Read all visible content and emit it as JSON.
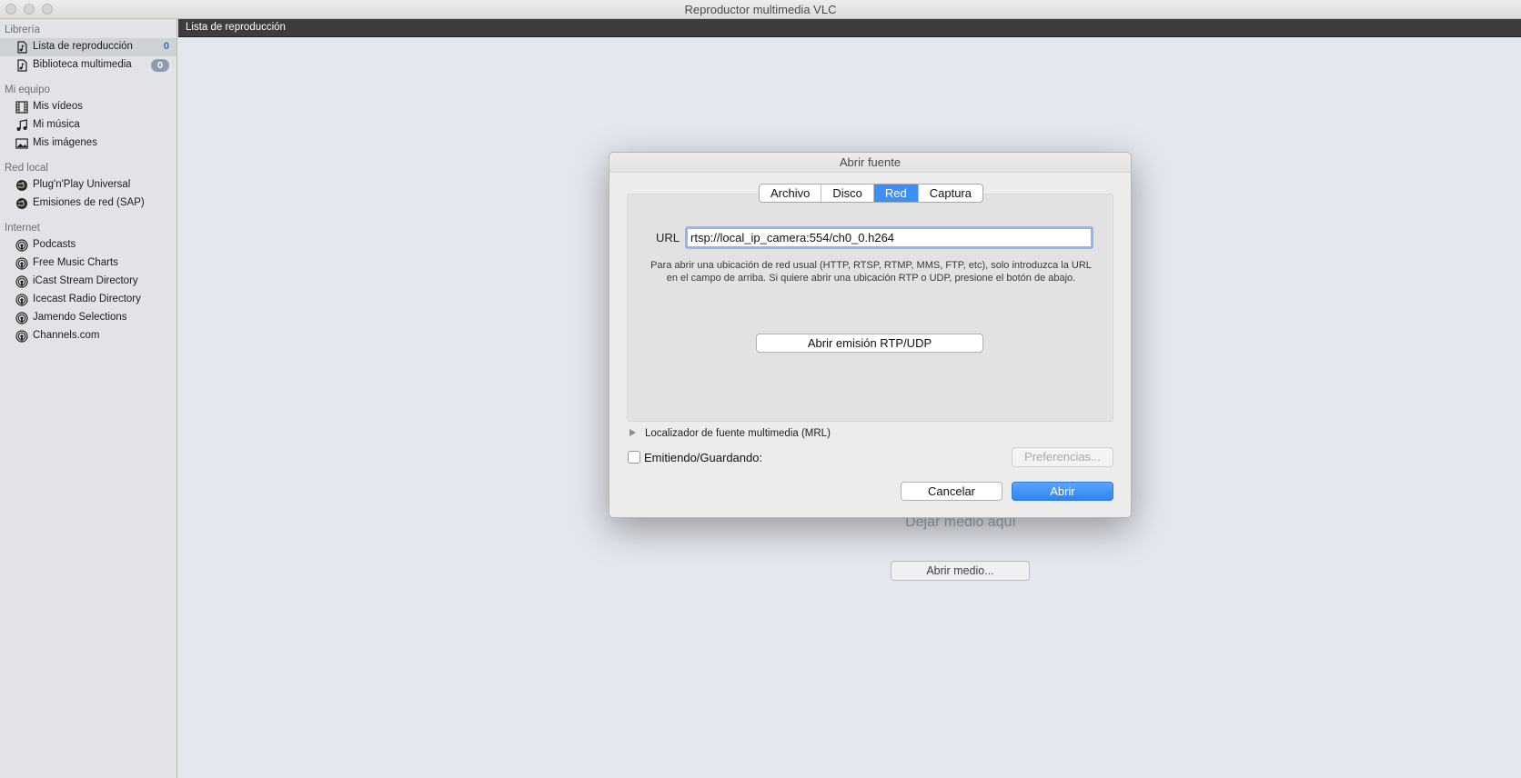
{
  "window": {
    "title": "Reproductor multimedia VLC"
  },
  "sidebar": {
    "sections": [
      {
        "title": "Librería",
        "items": [
          {
            "label": "Lista de reproducción",
            "count": "0",
            "icon": "playlist-file-icon"
          },
          {
            "label": "Biblioteca multimedia",
            "count": "0",
            "icon": "library-file-icon"
          }
        ]
      },
      {
        "title": "Mi equipo",
        "items": [
          {
            "label": "Mis vídeos",
            "icon": "film-icon"
          },
          {
            "label": "Mi música",
            "icon": "music-note-icon"
          },
          {
            "label": "Mis imágenes",
            "icon": "picture-icon"
          }
        ]
      },
      {
        "title": "Red local",
        "items": [
          {
            "label": "Plug'n'Play Universal",
            "icon": "network-icon"
          },
          {
            "label": "Emisiones de red (SAP)",
            "icon": "network-icon"
          }
        ]
      },
      {
        "title": "Internet",
        "items": [
          {
            "label": "Podcasts",
            "icon": "podcast-icon"
          },
          {
            "label": "Free Music Charts",
            "icon": "podcast-icon"
          },
          {
            "label": "iCast Stream Directory",
            "icon": "podcast-icon"
          },
          {
            "label": "Icecast Radio Directory",
            "icon": "podcast-icon"
          },
          {
            "label": "Jamendo Selections",
            "icon": "podcast-icon"
          },
          {
            "label": "Channels.com",
            "icon": "podcast-icon"
          }
        ]
      }
    ]
  },
  "main": {
    "header": "Lista de reproducción",
    "drop_text": "Dejar medio aquí",
    "open_media_label": "Abrir medio..."
  },
  "dialog": {
    "title": "Abrir fuente",
    "tabs": [
      {
        "label": "Archivo",
        "active": false
      },
      {
        "label": "Disco",
        "active": false
      },
      {
        "label": "Red",
        "active": true
      },
      {
        "label": "Captura",
        "active": false
      }
    ],
    "url_label": "URL",
    "url_value": "rtsp://local_ip_camera:554/ch0_0.h264",
    "help_text": "Para abrir una ubicación de red usual (HTTP, RTSP, RTMP, MMS, FTP, etc), solo introduzca la URL en el campo de arriba. Si quiere abrir una ubicación RTP o UDP, presione el botón de abajo.",
    "rtp_button": "Abrir emisión RTP/UDP",
    "mrl_label": "Localizador de fuente multimedia (MRL)",
    "stream_label": "Emitiendo/Guardando:",
    "stream_checked": false,
    "preferences_button": "Preferencias...",
    "cancel_button": "Cancelar",
    "open_button": "Abrir"
  },
  "colors": {
    "accent": "#3b8ff5",
    "header_bg": "#3d3d3d",
    "sidebar_bg": "#e1e3e6"
  }
}
